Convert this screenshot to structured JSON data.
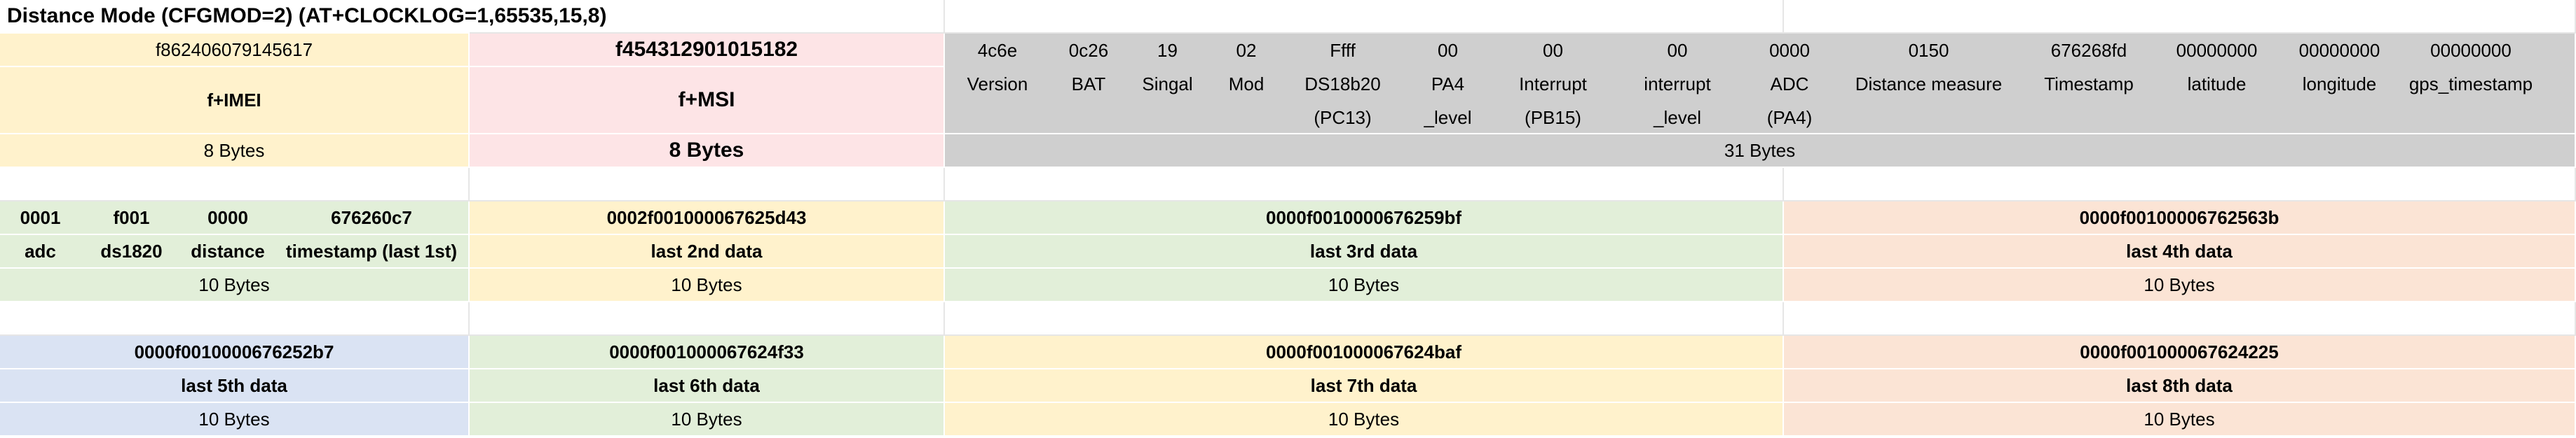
{
  "title": "Distance Mode  (CFGMOD=2)  (AT+CLOCKLOG=1,65535,15,8)",
  "header": {
    "imei_value": "f862406079145617",
    "imei_label": "f+IMEI",
    "imei_bytes": "8 Bytes",
    "imsi_value": "f454312901015182",
    "imsi_label": "f+MSI",
    "imsi_bytes": "8 Bytes",
    "payload_bytes": "31 Bytes"
  },
  "fields": [
    {
      "value": "4c6e",
      "label": "Version",
      "label2": ""
    },
    {
      "value": "0c26",
      "label": "BAT",
      "label2": ""
    },
    {
      "value": "19",
      "label": "Singal",
      "label2": ""
    },
    {
      "value": "02",
      "label": "Mod",
      "label2": ""
    },
    {
      "value": "Ffff",
      "label": "DS18b20",
      "label2": "(PC13)"
    },
    {
      "value": "00",
      "label": "PA4",
      "label2": "_level"
    },
    {
      "value": "00",
      "label": "Interrupt",
      "label2": "(PB15)"
    },
    {
      "value": "00",
      "label": "interrupt",
      "label2": "_level"
    },
    {
      "value": "0000",
      "label": "ADC",
      "label2": "(PA4)"
    },
    {
      "value": "0150",
      "label": "Distance measure",
      "label2": ""
    },
    {
      "value": "676268fd",
      "label": "Timestamp",
      "label2": ""
    },
    {
      "value": "00000000",
      "label": "latitude",
      "label2": ""
    },
    {
      "value": "00000000",
      "label": "longitude",
      "label2": ""
    },
    {
      "value": "00000000",
      "label": "gps_timestamp",
      "label2": ""
    }
  ],
  "first_record": {
    "adc_value": "0001",
    "ds1820_value": "f001",
    "distance_value": "0000",
    "timestamp_value": "676260c7",
    "adc_label": "adc",
    "ds1820_label": "ds1820",
    "distance_label": "distance",
    "timestamp_label": "timestamp (last 1st)",
    "bytes": "10 Bytes"
  },
  "records": [
    {
      "value": "0002f001000067625d43",
      "label": "last 2nd data",
      "bytes": "10 Bytes"
    },
    {
      "value": "0000f0010000676259bf",
      "label": "last 3rd data",
      "bytes": "10 Bytes"
    },
    {
      "value": "0000f00100006762563b",
      "label": "last 4th data",
      "bytes": "10 Bytes"
    },
    {
      "value": "0000f0010000676252b7",
      "label": "last 5th data",
      "bytes": "10 Bytes"
    },
    {
      "value": "0000f001000067624f33",
      "label": "last 6th data",
      "bytes": "10 Bytes"
    },
    {
      "value": "0000f001000067624baf",
      "label": "last 7th data",
      "bytes": "10 Bytes"
    },
    {
      "value": "0000f00100006762422 5",
      "label": "last 8th data",
      "bytes": "10 Bytes"
    }
  ],
  "colors": {
    "yellow": "#fff2cc",
    "pink": "#fde4e6",
    "grey": "#cfcfcf",
    "green": "#e2efd9",
    "peach": "#fbe4d5",
    "blue": "#dae3f3"
  }
}
